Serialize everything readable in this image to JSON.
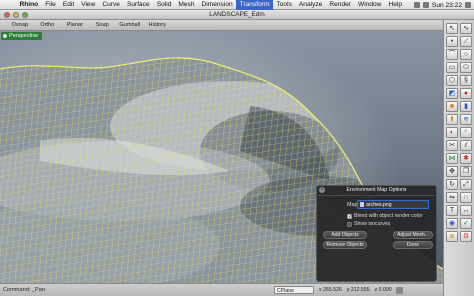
{
  "menubar": {
    "app": "Rhino",
    "items": [
      "File",
      "Edit",
      "View",
      "Curve",
      "Surface",
      "Solid",
      "Mesh",
      "Dimension",
      "Transform",
      "Tools",
      "Analyze",
      "Render",
      "Window",
      "Help"
    ],
    "active_item": "Transform",
    "clock": "Sun 23:22"
  },
  "window": {
    "title": "LANDSCAPE_Edm"
  },
  "toolbar": {
    "items": [
      "Osnap",
      "Ortho",
      "Planar",
      "Snap",
      "Gumball",
      "History"
    ]
  },
  "viewport": {
    "label": "Perspective",
    "mesh_color": "#e4e65a",
    "tab_color": "#2f7d3a"
  },
  "env_dialog": {
    "title": "Environment Map Options",
    "map_label": "Map:",
    "map_value": "arches.png",
    "blend_label": "Blend with object render color",
    "show_isocurves_label": "Show isocurves",
    "add_objects": "Add Objects",
    "adjust_mesh": "Adjust Mesh...",
    "remove_objects": "Remove Objects",
    "done": "Done"
  },
  "statusbar": {
    "command": "Command: _Pan",
    "cplane": "CPlane",
    "x": "x 265.526",
    "y": "y 212.555",
    "z": "z 0.000"
  },
  "palette": {
    "icons": [
      "pointer-icon",
      "curve-icon",
      "point-icon",
      "polyline-icon",
      "arc-icon",
      "circle-icon",
      "rectangle-icon",
      "ellipse-icon",
      "polygon-icon",
      "freeform-icon",
      "surface-icon",
      "sphere-icon",
      "box-icon",
      "cylinder-icon",
      "extrude-icon",
      "loft-icon",
      "boolean-icon",
      "fillet-icon",
      "trim-icon",
      "split-icon",
      "join-icon",
      "explode-icon",
      "move-icon",
      "copy-icon",
      "rotate-icon",
      "scale-icon",
      "mirror-icon",
      "array-icon",
      "text-icon",
      "dimension-icon",
      "render-icon",
      "check-icon",
      "layer-icon",
      "properties-icon"
    ]
  }
}
